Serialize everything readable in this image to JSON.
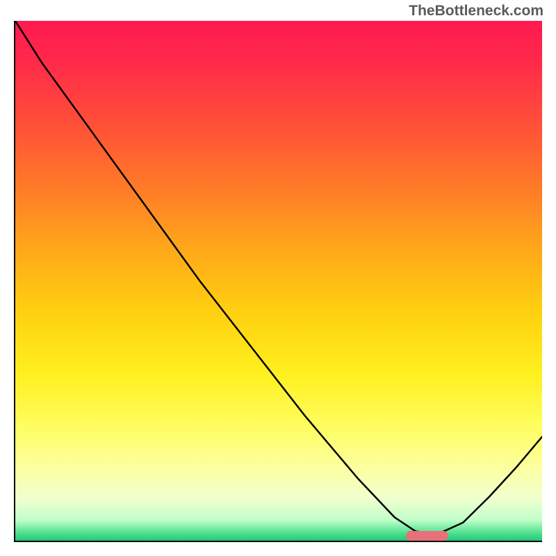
{
  "watermark": "TheBottleneck.com",
  "chart_data": {
    "type": "line",
    "title": "",
    "xlabel": "",
    "ylabel": "",
    "x": [
      0.0,
      0.05,
      0.15,
      0.25,
      0.35,
      0.45,
      0.55,
      0.65,
      0.72,
      0.76,
      0.8,
      0.85,
      0.9,
      0.95,
      1.0
    ],
    "values": [
      1.0,
      0.92,
      0.78,
      0.64,
      0.5,
      0.37,
      0.24,
      0.12,
      0.045,
      0.018,
      0.012,
      0.035,
      0.085,
      0.14,
      0.2
    ],
    "xlim": [
      0,
      1
    ],
    "ylim": [
      0,
      1
    ],
    "optimum_marker": {
      "x_start": 0.74,
      "x_end": 0.82,
      "y": 0.012
    },
    "annotations": [
      "TheBottleneck.com"
    ]
  },
  "colors": {
    "curve": "#000000",
    "marker": "#e8707a",
    "axis": "#000000",
    "gradient_top": "#ff1a50",
    "gradient_bottom": "#20c878"
  }
}
